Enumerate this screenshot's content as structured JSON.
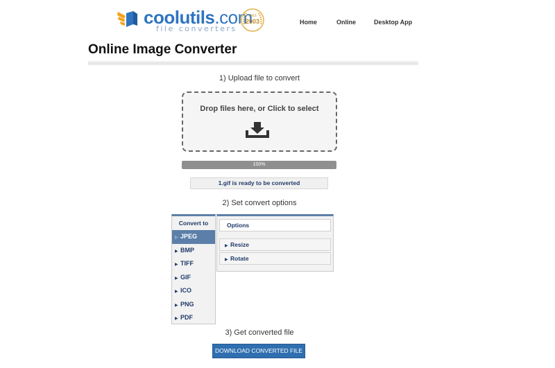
{
  "header": {
    "brand": "coolutils",
    "brand_suffix": ".com",
    "tagline": "file converters",
    "since_label": "SINCE",
    "since_year": "2003",
    "nav": [
      "Home",
      "Online",
      "Desktop App"
    ]
  },
  "page": {
    "title": "Online Image Converter"
  },
  "steps": {
    "upload": "1) Upload file to convert",
    "options": "2) Set convert options",
    "result": "3) Get converted file"
  },
  "dropzone": {
    "text": "Drop files here, or Click to select",
    "icon": "download-tray-icon"
  },
  "progress": {
    "value": 1.0,
    "label": "100%"
  },
  "status": {
    "text": "1.gif is ready to be converted"
  },
  "convert_to": {
    "header": "Convert to",
    "formats": [
      "JPEG",
      "BMP",
      "TIFF",
      "GIF",
      "ICO",
      "PNG",
      "PDF"
    ],
    "selected": "JPEG"
  },
  "options_panel": {
    "header": "Options",
    "items": [
      "Resize",
      "Rotate"
    ]
  },
  "download": {
    "label": "DOWNLOAD CONVERTED FILE"
  },
  "colors": {
    "brand_blue": "#2f74c0",
    "accent": "#5b7fa8",
    "button": "#2f6fb0",
    "text_dark_blue": "#1f3a68"
  }
}
